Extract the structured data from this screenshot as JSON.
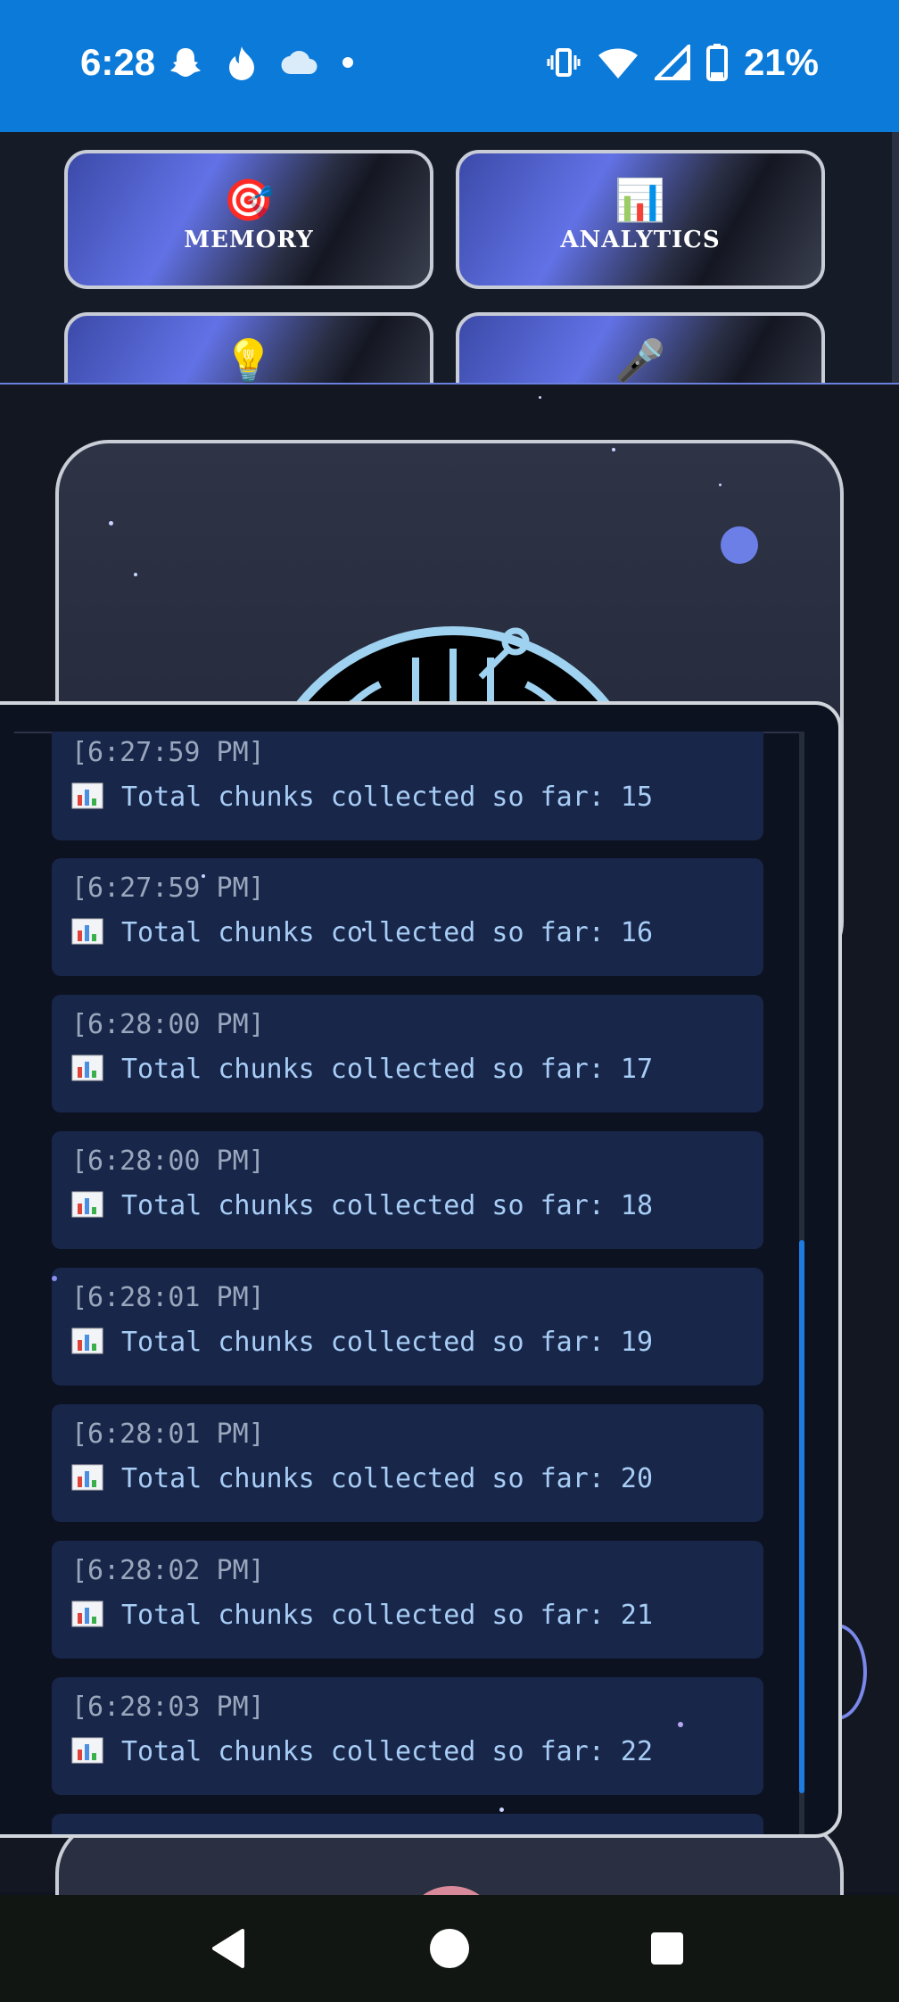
{
  "status_bar": {
    "time": "6:28",
    "battery_percent": "21%",
    "left_icons": [
      "snapchat-icon",
      "tinder-flame-icon",
      "cloud-icon",
      "notification-dot-icon"
    ],
    "right_icons": [
      "vibrate-icon",
      "wifi-icon",
      "cell-signal-icon",
      "battery-icon"
    ]
  },
  "nav_cards": [
    {
      "icon": "🎯",
      "label": "MEMORY"
    },
    {
      "icon": "📊",
      "label": "ANALYTICS"
    },
    {
      "icon": "💡",
      "label": ""
    },
    {
      "icon": "🎤",
      "label": ""
    }
  ],
  "log": {
    "entries": [
      {
        "time": "[6:27:59 PM]",
        "icon": "bar-chart-icon",
        "message": "Total chunks collected so far: 15"
      },
      {
        "time": "[6:27:59 PM]",
        "icon": "bar-chart-icon",
        "message": "Total chunks collected so far: 16"
      },
      {
        "time": "[6:28:00 PM]",
        "icon": "bar-chart-icon",
        "message": "Total chunks collected so far: 17"
      },
      {
        "time": "[6:28:00 PM]",
        "icon": "bar-chart-icon",
        "message": "Total chunks collected so far: 18"
      },
      {
        "time": "[6:28:01 PM]",
        "icon": "bar-chart-icon",
        "message": "Total chunks collected so far: 19"
      },
      {
        "time": "[6:28:01 PM]",
        "icon": "bar-chart-icon",
        "message": "Total chunks collected so far: 20"
      },
      {
        "time": "[6:28:02 PM]",
        "icon": "bar-chart-icon",
        "message": "Total chunks collected so far: 21"
      },
      {
        "time": "[6:28:03 PM]",
        "icon": "bar-chart-icon",
        "message": "Total chunks collected so far: 22"
      }
    ]
  },
  "nav_bar": {
    "buttons": [
      "back-icon",
      "home-icon",
      "recents-icon"
    ]
  },
  "colors": {
    "status_bar": "#0c7ad9",
    "panel_bg": "#0d1220",
    "entry_bg": "#18264a",
    "message_text": "#a8cdf5",
    "timestamp_text": "#9aa6bb",
    "accent": "#6b7fe6",
    "scroll_thumb": "#1e7be0"
  }
}
